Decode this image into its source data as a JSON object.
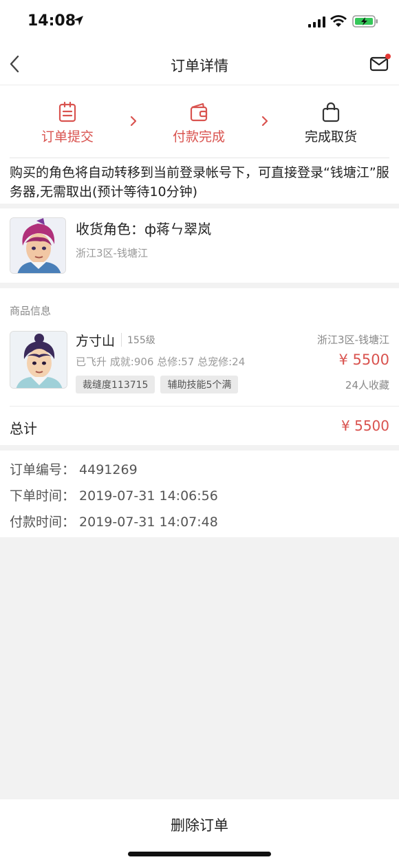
{
  "status_bar": {
    "time": "14:08"
  },
  "nav": {
    "title": "订单详情"
  },
  "steps": [
    {
      "label": "订单提交",
      "icon": "clipboard-icon",
      "state": "active"
    },
    {
      "label": "付款完成",
      "icon": "wallet-icon",
      "state": "active"
    },
    {
      "label": "完成取货",
      "icon": "bag-icon",
      "state": "pending"
    }
  ],
  "notice": {
    "text": "购买的角色将自动转移到当前登录帐号下，可直接登录“钱塘江”服务器,无需取出(预计等待10分钟)"
  },
  "receiver": {
    "title": "收货角色：ф蒋ㄣ翠岚",
    "server": "浙江3区-钱塘江"
  },
  "goods": {
    "section_title": "商品信息",
    "name": "方寸山",
    "level": "155级",
    "server": "浙江3区-钱塘江",
    "stats": "已飞升  成就:906  总修:57  总宠修:24",
    "price": "¥ 5500",
    "tags": [
      "裁缝度113715",
      "辅助技能5个满"
    ],
    "favorites": "24人收藏"
  },
  "total": {
    "label": "总计",
    "value": "¥ 5500"
  },
  "order_info": {
    "order_no": "订单编号：  4491269",
    "order_time": "下单时间：  2019-07-31 14:06:56",
    "pay_time": "付款时间：  2019-07-31 14:07:48"
  },
  "bottom": {
    "delete_label": "删除订单"
  },
  "colors": {
    "accent": "#d9534f",
    "background": "#f2f2f2"
  }
}
